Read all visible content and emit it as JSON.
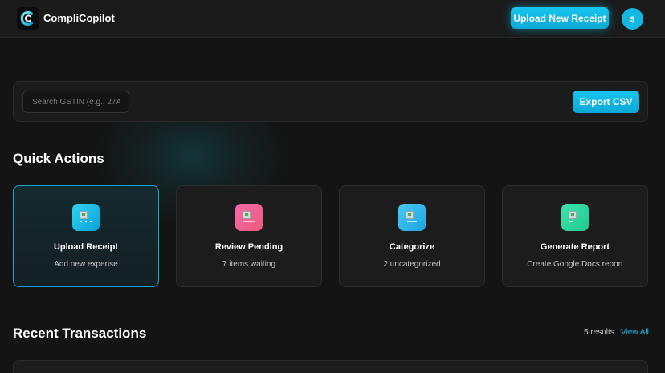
{
  "app": {
    "title": "CompliCopilot"
  },
  "header": {
    "upload_label": "Upload New Receipt",
    "avatar_initial": "S"
  },
  "toolbar": {
    "search_placeholder": "Search GSTIN (e.g., 27A",
    "search_value": "",
    "export_label": "Export CSV"
  },
  "quick_actions": {
    "title": "Quick Actions",
    "cards": [
      {
        "title": "Upload Receipt",
        "subtitle": "Add new expense",
        "icon": "image-icon",
        "color": "#13b8e2",
        "active": true
      },
      {
        "title": "Review Pending",
        "subtitle": "7 items waiting",
        "icon": "image-icon",
        "color": "#ef5a8c",
        "active": false
      },
      {
        "title": "Categorize",
        "subtitle": "2 uncategorized",
        "icon": "image-icon",
        "color": "#2fb7ea",
        "active": false
      },
      {
        "title": "Generate Report",
        "subtitle": "Create Google Docs report",
        "icon": "image-icon",
        "color": "#2fd7a0",
        "active": false
      }
    ]
  },
  "recent": {
    "title": "Recent Transactions",
    "results": "5 results",
    "view_all": "View All"
  },
  "colors": {
    "accent": "#13b8e2",
    "background": "#141414",
    "card": "#1c1c1c"
  }
}
